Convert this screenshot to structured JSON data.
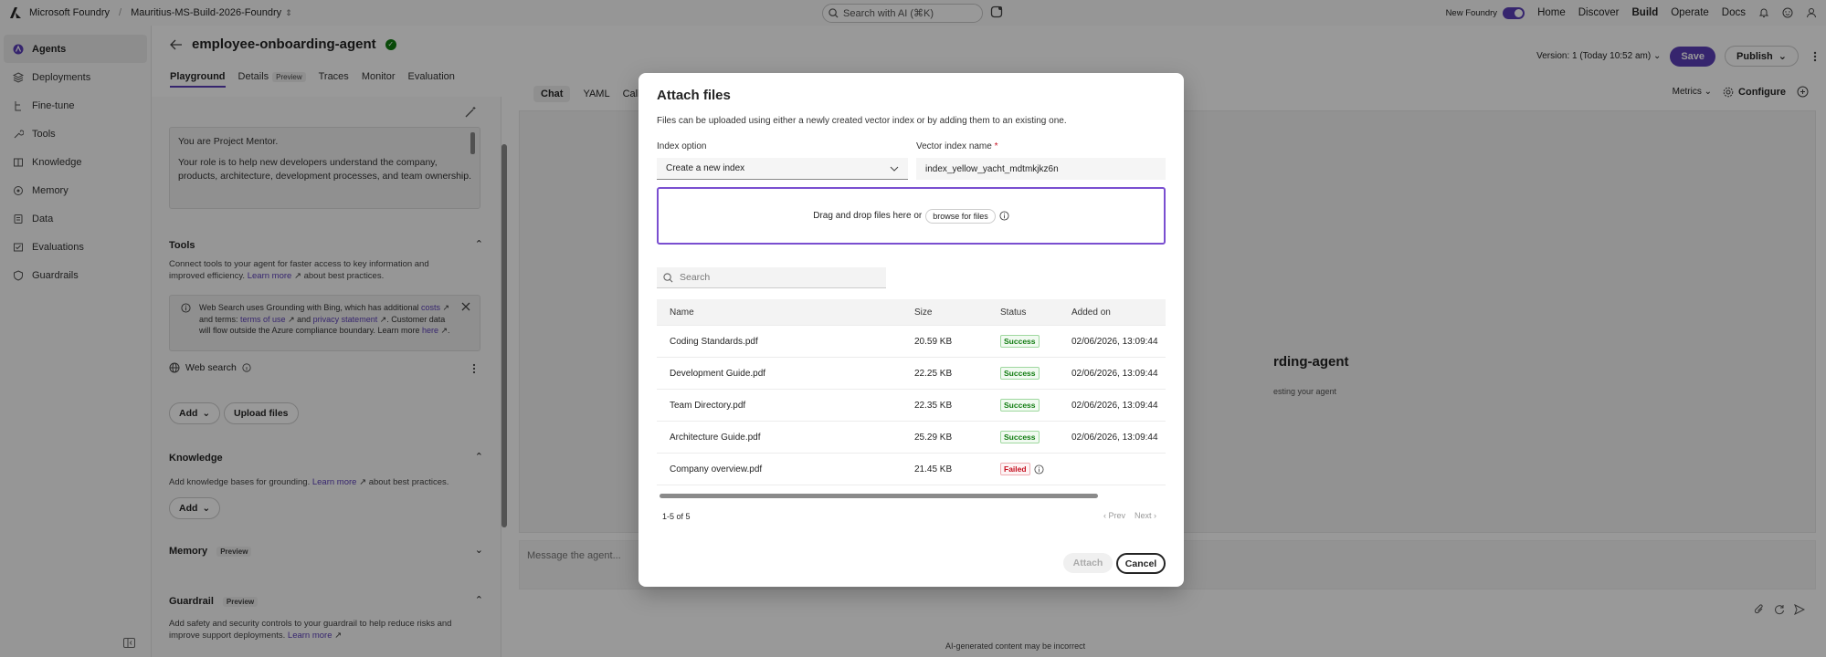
{
  "topbar": {
    "app_name": "Microsoft Foundry",
    "separator": "/",
    "project": "Mauritius-MS-Build-2026-Foundry",
    "search_placeholder": "Search with AI (⌘K)",
    "new_foundry_label": "New Foundry",
    "nav": [
      "Home",
      "Discover",
      "Build",
      "Operate",
      "Docs"
    ],
    "active_nav": "Build"
  },
  "sidebar": {
    "items": [
      {
        "label": "Agents",
        "icon": "agents-icon",
        "active": true
      },
      {
        "label": "Deployments",
        "icon": "deployments-icon"
      },
      {
        "label": "Fine-tune",
        "icon": "fine-tune-icon"
      },
      {
        "label": "Tools",
        "icon": "tools-icon"
      },
      {
        "label": "Knowledge",
        "icon": "knowledge-icon"
      },
      {
        "label": "Memory",
        "icon": "memory-icon"
      },
      {
        "label": "Data",
        "icon": "data-icon"
      },
      {
        "label": "Evaluations",
        "icon": "evaluations-icon"
      },
      {
        "label": "Guardrails",
        "icon": "guardrails-icon"
      }
    ]
  },
  "agent": {
    "name": "employee-onboarding-agent",
    "tabs": [
      {
        "label": "Playground",
        "active": true
      },
      {
        "label": "Details",
        "badge": "Preview"
      },
      {
        "label": "Traces"
      },
      {
        "label": "Monitor"
      },
      {
        "label": "Evaluation"
      }
    ],
    "version": "Version: 1 (Today 10:52 am)",
    "save_label": "Save",
    "publish_label": "Publish"
  },
  "playground": {
    "instructions": [
      "You are Project Mentor.",
      "Your role is to help new developers understand the company, products, architecture, development processes, and team ownership."
    ],
    "tools": {
      "title": "Tools",
      "desc_prefix": "Connect tools to your agent for faster access to key information and improved efficiency.",
      "learn_more": "Learn more",
      "desc_suffix": "about best practices.",
      "info_1": "Web Search uses Grounding with Bing, which has additional",
      "info_costs": "costs",
      "info_2": "and terms:",
      "info_terms": "terms of use",
      "info_3": "and",
      "info_privacy": "privacy statement",
      "info_4": ". Customer data will flow outside the Azure compliance boundary. Learn more",
      "info_here": "here",
      "info_5": ".",
      "web_search": "Web search",
      "add_label": "Add",
      "upload_label": "Upload files"
    },
    "knowledge": {
      "title": "Knowledge",
      "desc_prefix": "Add knowledge bases for grounding.",
      "learn_more": "Learn more",
      "desc_suffix": "about best practices.",
      "add_label": "Add"
    },
    "memory": {
      "title": "Memory",
      "badge": "Preview"
    },
    "guardrail": {
      "title": "Guardrail",
      "badge": "Preview",
      "desc": "Add safety and security controls to your guardrail to help reduce risks and improve support deployments.",
      "learn_more": "Learn more"
    }
  },
  "chat": {
    "tabs": [
      "Chat",
      "YAML",
      "Call"
    ],
    "metrics_label": "Metrics",
    "configure_label": "Configure",
    "title_fragment": "rding-agent",
    "subtitle_fragment": "esting your agent",
    "message_placeholder": "Message the agent...",
    "disclaimer": "AI-generated content may be incorrect"
  },
  "modal": {
    "title": "Attach files",
    "subtitle": "Files can be uploaded using either a newly created vector index or by adding them to an existing one.",
    "index_option_label": "Index option",
    "index_option_value": "Create a new index",
    "vector_index_label": "Vector index name",
    "vector_index_value": "index_yellow_yacht_mdtmkjkz6n",
    "drop_text": "Drag and drop files here or",
    "browse_label": "browse for files",
    "search_placeholder": "Search",
    "columns": [
      "Name",
      "Size",
      "Status",
      "Added on"
    ],
    "rows": [
      {
        "name": "Coding Standards.pdf",
        "size": "20.59 KB",
        "status": "Success",
        "added": "02/06/2026, 13:09:44"
      },
      {
        "name": "Development Guide.pdf",
        "size": "22.25 KB",
        "status": "Success",
        "added": "02/06/2026, 13:09:44"
      },
      {
        "name": "Team Directory.pdf",
        "size": "22.35 KB",
        "status": "Success",
        "added": "02/06/2026, 13:09:44"
      },
      {
        "name": "Architecture Guide.pdf",
        "size": "25.29 KB",
        "status": "Success",
        "added": "02/06/2026, 13:09:44"
      },
      {
        "name": "Company overview.pdf",
        "size": "21.45 KB",
        "status": "Failed",
        "added": ""
      }
    ],
    "pager_info": "1-5 of 5",
    "prev_label": "Prev",
    "next_label": "Next",
    "attach_label": "Attach",
    "cancel_label": "Cancel"
  },
  "colors": {
    "accent": "#5b3fb8",
    "success": "#107c10",
    "failed": "#c50f1f",
    "overlay": "rgba(0,0,0,0.40)"
  }
}
